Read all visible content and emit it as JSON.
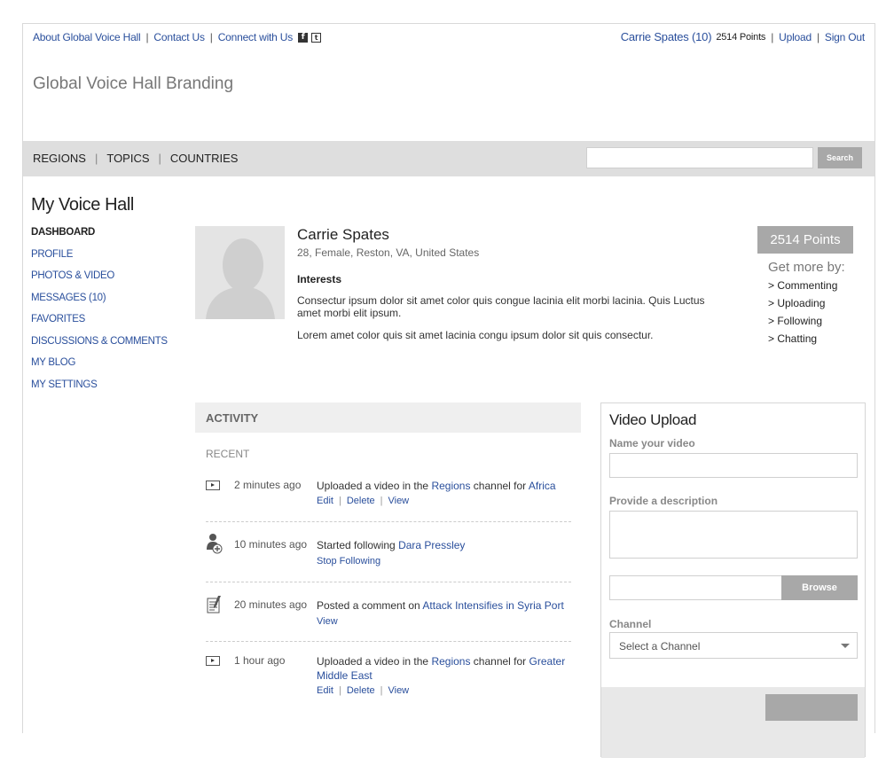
{
  "header": {
    "links": [
      "About Global Voice Hall",
      "Contact Us",
      "Connect with Us"
    ],
    "social_icons": [
      {
        "name": "facebook-icon",
        "glyph": "f"
      },
      {
        "name": "twitter-icon",
        "glyph": "t"
      }
    ],
    "user_name": "Carrie Spates (10)",
    "user_points": "2514 Points",
    "upload_label": "Upload",
    "signout_label": "Sign Out"
  },
  "brand": "Global Voice Hall Branding",
  "nav": {
    "items": [
      "REGIONS",
      "TOPICS",
      "COUNTRIES"
    ],
    "search_placeholder": "",
    "search_button": "Search"
  },
  "sidebar": {
    "title": "My Voice Hall",
    "items": [
      {
        "label": "DASHBOARD",
        "active": true
      },
      {
        "label": "PROFILE"
      },
      {
        "label": "PHOTOS & VIDEO"
      },
      {
        "label": "MESSAGES (10)"
      },
      {
        "label": "FAVORITES"
      },
      {
        "label": "DISCUSSIONS & COMMENTS"
      },
      {
        "label": "MY BLOG"
      },
      {
        "label": "MY SETTINGS"
      }
    ]
  },
  "profile": {
    "name": "Carrie Spates",
    "meta": "28, Female, Reston, VA, United States",
    "interests_heading": "Interests",
    "paragraph1": "Consectur ipsum dolor sit amet color quis congue lacinia elit morbi lacinia. Quis Luctus amet morbi elit ipsum.",
    "paragraph2": "Lorem amet color quis sit amet lacinia congu ipsum dolor sit quis consectur."
  },
  "points": {
    "badge": "2514 Points",
    "get_more": "Get more by:",
    "ways": [
      "> Commenting",
      "> Uploading",
      "> Following",
      "> Chatting"
    ]
  },
  "activity": {
    "heading": "ACTIVITY",
    "subheading": "RECENT",
    "items": [
      {
        "icon": "video-icon",
        "time": "2 minutes ago",
        "text": "Uploaded a video in the ",
        "link1": "Regions",
        "text2": " channel for ",
        "link2": "Africa",
        "actions": [
          "Edit",
          "Delete",
          "View"
        ]
      },
      {
        "icon": "follow-user-icon",
        "time": "10 minutes ago",
        "text": "Started following ",
        "link1": "Dara Pressley",
        "actions": [
          "Stop Following"
        ]
      },
      {
        "icon": "comment-icon",
        "time": "20 minutes ago",
        "text": "Posted a comment on ",
        "link1": "Attack Intensifies in Syria Port",
        "actions": [
          "View"
        ]
      },
      {
        "icon": "video-icon",
        "time": "1 hour ago",
        "text": "Uploaded a video in the ",
        "link1": "Regions",
        "text2": " channel for ",
        "link2": "Greater Middle East",
        "actions": [
          "Edit",
          "Delete",
          "View"
        ]
      }
    ]
  },
  "video_upload": {
    "title": "Video Upload",
    "name_label": "Name your video",
    "desc_label": "Provide a description",
    "browse_label": "Browse",
    "channel_label": "Channel",
    "channel_value": "Select a Channel"
  }
}
